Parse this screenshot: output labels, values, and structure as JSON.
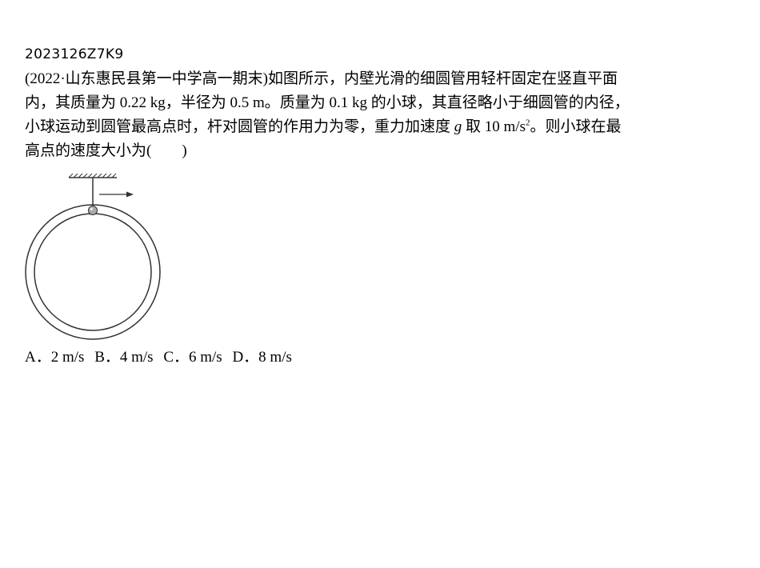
{
  "question": {
    "id": "2023126Z7K9",
    "line1": "(2022·山东惠民县第一中学高一期末)如图所示，内壁光滑的细圆管用轻杆固定在竖直平面",
    "line2": "内，其质量为 0.22 kg，半径为 0.5 m。质量为 0.1 kg 的小球，其直径略小于细圆管的内径，",
    "line3_a": "小球运动到圆管最高点时，杆对圆管的作用力为零，重力加速度 ",
    "line3_g": "g",
    "line3_b": " 取 10 m/s",
    "line3_sup": "2",
    "line3_c": "。则小球在最",
    "line4": "高点的速度大小为(　　)"
  },
  "options": {
    "a": "A．2 m/s",
    "b": "B．4 m/s",
    "c": "C．6 m/s",
    "d": "D．8 m/s"
  },
  "figure": {
    "components": [
      "ceiling-support-icon",
      "rod",
      "ball-icon",
      "velocity-arrow-icon",
      "tube-ring"
    ],
    "colors": {
      "stroke": "#333333",
      "ball": "#aaaaaa"
    }
  }
}
